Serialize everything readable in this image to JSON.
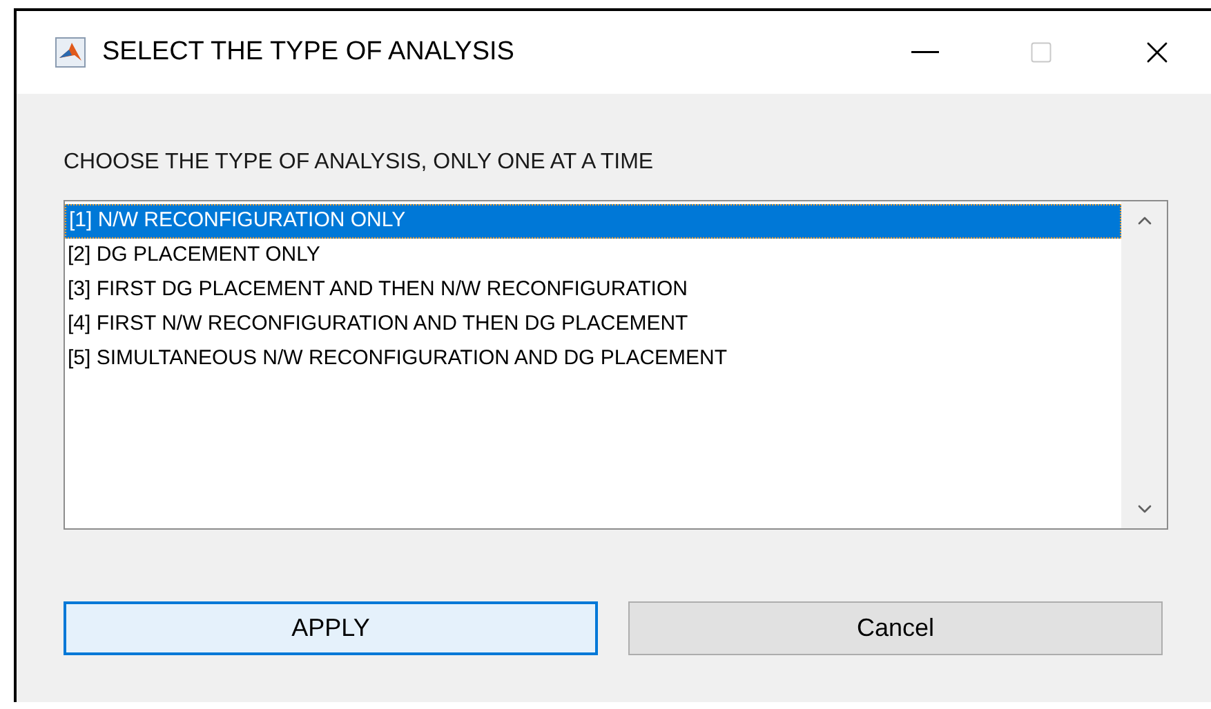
{
  "window": {
    "title": "SELECT THE TYPE OF ANALYSIS"
  },
  "prompt": "CHOOSE THE TYPE OF ANALYSIS, ONLY ONE AT A TIME",
  "options": [
    {
      "label": "[1] N/W RECONFIGURATION ONLY",
      "selected": true
    },
    {
      "label": "[2] DG PLACEMENT ONLY",
      "selected": false
    },
    {
      "label": "[3] FIRST DG PLACEMENT AND THEN N/W RECONFIGURATION",
      "selected": false
    },
    {
      "label": "[4] FIRST N/W RECONFIGURATION AND THEN DG PLACEMENT",
      "selected": false
    },
    {
      "label": "[5] SIMULTANEOUS N/W RECONFIGURATION AND DG PLACEMENT",
      "selected": false
    }
  ],
  "buttons": [
    {
      "label": "APPLY",
      "kind": "default"
    },
    {
      "label": "Cancel",
      "kind": "normal"
    }
  ]
}
